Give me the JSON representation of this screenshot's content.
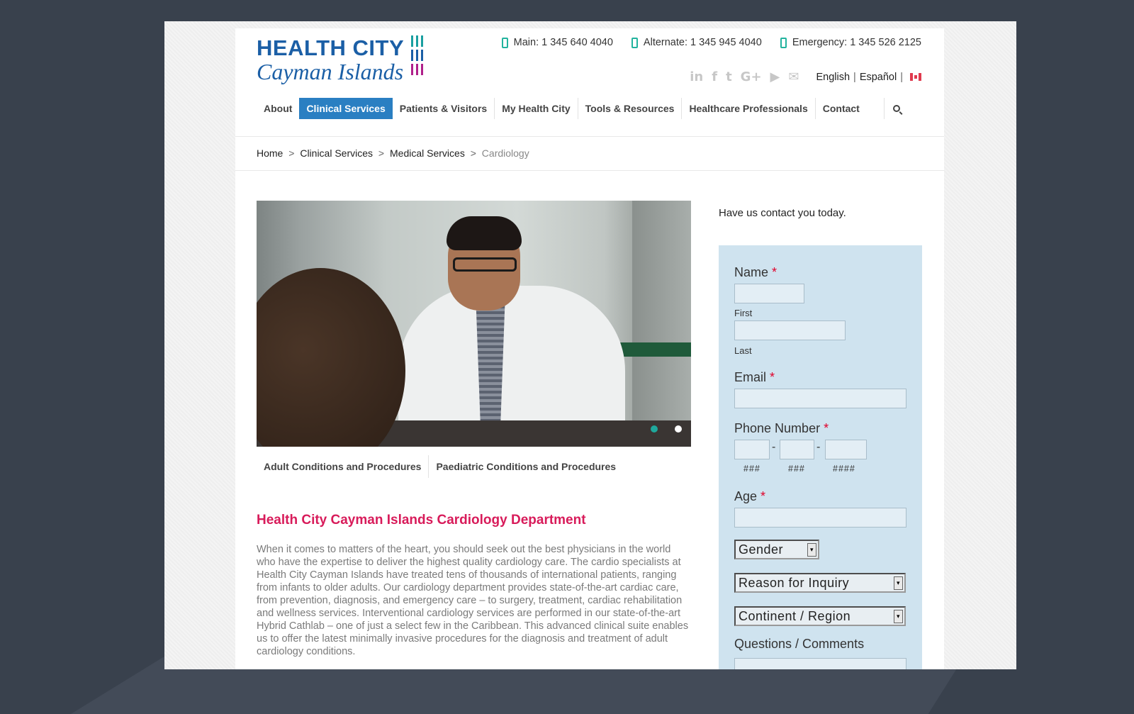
{
  "logo": {
    "line1": "HEALTH CITY",
    "line2": "Cayman Islands",
    "bar_colors": [
      "#1a9fa0",
      "#1b5fa6",
      "#b0208a"
    ]
  },
  "contacts": [
    {
      "label": "Main: 1 345 640 4040"
    },
    {
      "label": "Alternate: 1 345 945 4040"
    },
    {
      "label": "Emergency: 1 345 526 2125"
    }
  ],
  "social": [
    "linkedin-icon",
    "facebook-icon",
    "twitter-icon",
    "google-plus-icon",
    "youtube-icon",
    "email-icon"
  ],
  "social_glyphs": [
    "in",
    "f",
    "t",
    "G+",
    "▶",
    "✉"
  ],
  "language": {
    "english": "English",
    "separator": "|",
    "espanol": "Español"
  },
  "nav": [
    {
      "label": "About"
    },
    {
      "label": "Clinical Services"
    },
    {
      "label": "Patients & Visitors"
    },
    {
      "label": "My Health City"
    },
    {
      "label": "Tools & Resources"
    },
    {
      "label": "Healthcare Professionals"
    },
    {
      "label": "Contact"
    }
  ],
  "breadcrumb": {
    "home": "Home",
    "sep": ">",
    "clinical": "Clinical Services",
    "medical": "Medical Services",
    "current": "Cardiology"
  },
  "tabs": [
    "Adult Conditions and Procedures",
    "Paediatric Conditions and Procedures"
  ],
  "main": {
    "heading": "Health City Cayman Islands Cardiology Department",
    "body": "When it comes to matters of the heart, you should seek out the best physicians in the world who have the expertise to deliver the highest quality cardiology care. The cardio specialists at Health City Cayman Islands have treated tens of thousands of international patients, ranging from infants to older adults. Our cardiology department provides state-of-the-art cardiac care, from prevention, diagnosis, and emergency care – to surgery, treatment, cardiac rehabilitation and wellness services. Interventional cardiology services are performed in our state-of-the-art Hybrid Cathlab – one of just a select few in the Caribbean. This advanced clinical suite enables us to offer the latest minimally invasive procedures for the diagnosis and treatment of adult cardiology conditions."
  },
  "form": {
    "intro": "Have us contact you today.",
    "name_label": "Name",
    "required_mark": "*",
    "first": "First",
    "last": "Last",
    "email_label": "Email",
    "phone_label": "Phone Number",
    "phone_dash": "-",
    "phone_hints": [
      "###",
      "###",
      "####"
    ],
    "age_label": "Age",
    "gender": "Gender",
    "reason": "Reason for Inquiry",
    "region": "Continent / Region",
    "comments_label": "Questions / Comments",
    "select_arrow": "▾"
  },
  "colors": {
    "accent": "#2a7fc2",
    "heading": "#d81b5a",
    "form_bg": "#cfe3ef",
    "icon_teal": "#22b39e"
  }
}
